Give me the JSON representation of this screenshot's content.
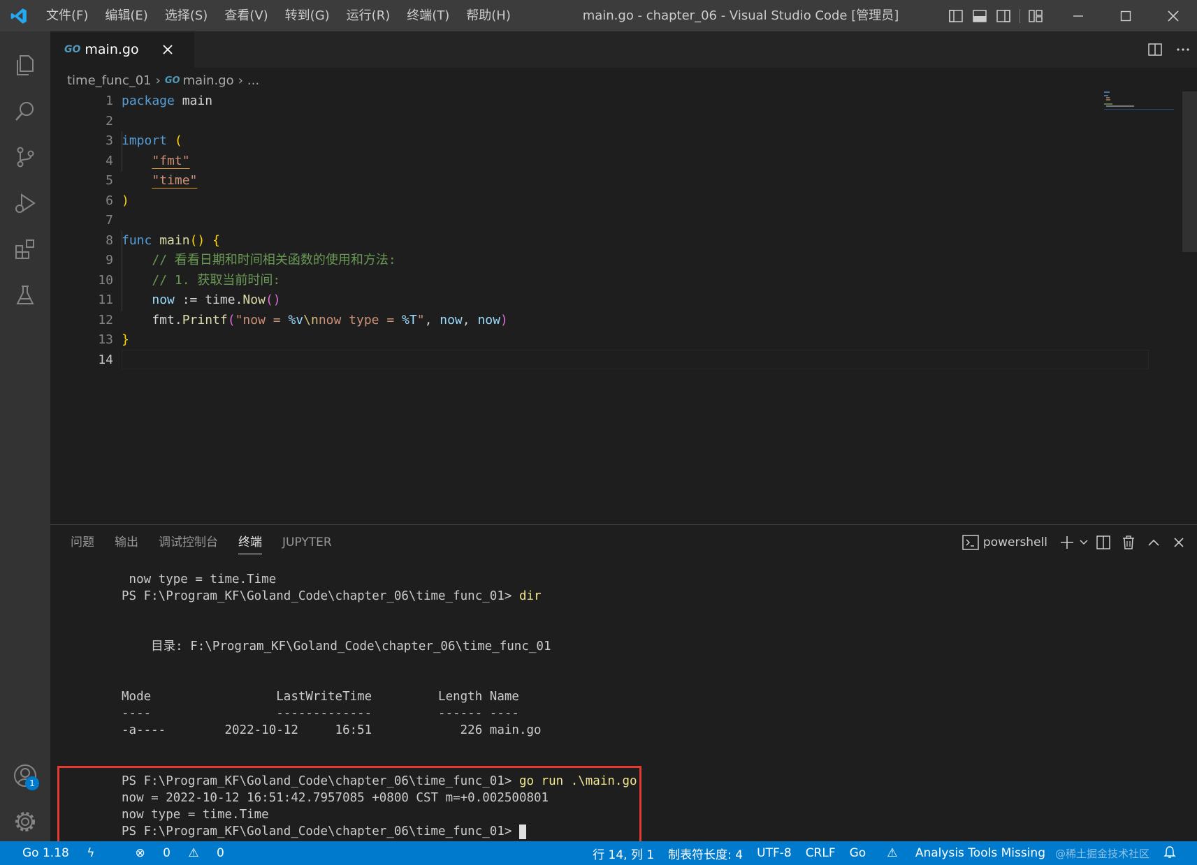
{
  "window": {
    "title": "main.go - chapter_06 - Visual Studio Code [管理员]",
    "menu": [
      "文件(F)",
      "编辑(E)",
      "选择(S)",
      "查看(V)",
      "转到(G)",
      "运行(R)",
      "终端(T)",
      "帮助(H)"
    ]
  },
  "activity_bar": {
    "accounts_badge": "1"
  },
  "tab": {
    "icon_text": "GO",
    "filename": "main.go",
    "close": "✕"
  },
  "breadcrumb": {
    "folder": "time_func_01",
    "icon_text": "GO",
    "file": "main.go",
    "more": "..."
  },
  "editor": {
    "line_numbers": [
      "1",
      "2",
      "3",
      "4",
      "5",
      "6",
      "7",
      "8",
      "9",
      "10",
      "11",
      "12",
      "13",
      "14"
    ],
    "active_line": "14"
  },
  "panel": {
    "tabs": [
      "问题",
      "输出",
      "调试控制台",
      "终端",
      "JUPYTER"
    ],
    "active_tab": "终端",
    "shell_name": "powershell"
  },
  "terminal": {
    "lines": [
      " now type = time.Time",
      "PS F:\\Program_KF\\Goland_Code\\chapter_06\\time_func_01> ",
      "",
      "",
      "    目录: F:\\Program_KF\\Goland_Code\\chapter_06\\time_func_01",
      "",
      "",
      "Mode                 LastWriteTime         Length Name",
      "----                 -------------         ------ ----",
      "-a----        2022-10-12     16:51            226 main.go",
      "",
      "",
      "PS F:\\Program_KF\\Goland_Code\\chapter_06\\time_func_01> ",
      "now = 2022-10-12 16:51:42.7957085 +0800 CST m=+0.002500801",
      "now type = time.Time",
      "PS F:\\Program_KF\\Goland_Code\\chapter_06\\time_func_01> "
    ],
    "cmd1": "dir",
    "cmd2": "go run .\\main.go"
  },
  "status_bar": {
    "go_version": "Go 1.18",
    "errors": "0",
    "warnings": "0",
    "position": "行 14, 列 1",
    "tab_size": "制表符长度: 4",
    "encoding": "UTF-8",
    "eol": "CRLF",
    "language": "Go",
    "analysis": "Analysis Tools Missing",
    "watermark": "@稀土掘金技术社区"
  },
  "colors": {
    "status_bar": "#007acc",
    "highlight_box": "#e33b30"
  }
}
